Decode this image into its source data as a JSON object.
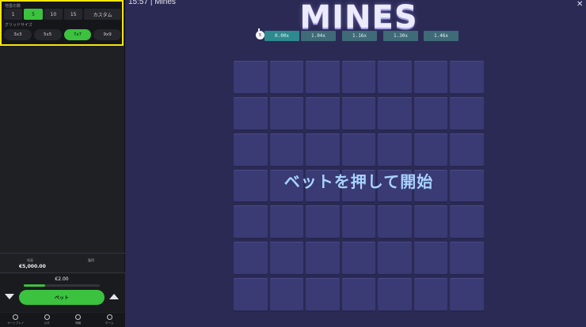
{
  "header": {
    "time": "15:57",
    "separator": "|",
    "game_name": "Mines",
    "close_glyph": "✕"
  },
  "logo": {
    "text": "MINES"
  },
  "config": {
    "mines_label": "地雷の数",
    "mine_options": [
      {
        "label": "1",
        "active": false
      },
      {
        "label": "5",
        "active": true
      },
      {
        "label": "10",
        "active": false
      },
      {
        "label": "15",
        "active": false
      },
      {
        "label": "カスタム",
        "active": false
      }
    ],
    "grid_label": "グリッドサイズ",
    "grid_options": [
      {
        "label": "3x3",
        "active": false
      },
      {
        "label": "5x5",
        "active": false
      },
      {
        "label": "7x7",
        "active": true
      },
      {
        "label": "9x9",
        "active": false
      }
    ]
  },
  "multipliers": {
    "mine_count": "5",
    "values": [
      "0.00x",
      "1.04x",
      "1.16x",
      "1.30x",
      "1.46x"
    ]
  },
  "board": {
    "rows": 7,
    "cols": 7,
    "message": "ベットを押して開始"
  },
  "stats": {
    "balance_label": "残高",
    "balance_value": "€5,000.00",
    "profit_label": "獲得"
  },
  "bet": {
    "amount": "€2.00",
    "button_label": "ベット",
    "progress": 0.28
  },
  "nav": [
    {
      "label": "オートプレイ",
      "icon": "autoplay-icon"
    },
    {
      "label": "公平",
      "icon": "fairness-icon"
    },
    {
      "label": "情報",
      "icon": "info-icon"
    },
    {
      "label": "ホーム",
      "icon": "home-icon"
    }
  ],
  "colors": {
    "accent": "#3bc23f",
    "highlight": "#f4e60b",
    "tile": "#3a3a74",
    "background": "#2b2a55"
  }
}
